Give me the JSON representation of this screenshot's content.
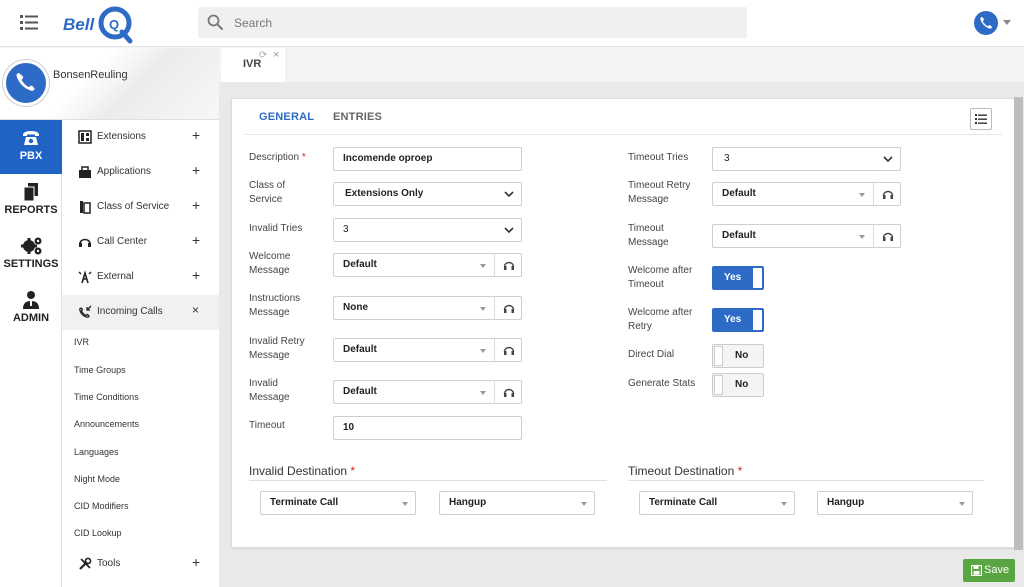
{
  "topbar": {
    "logo_text": "BellQ",
    "search_placeholder": "Search"
  },
  "user": {
    "name": "BonsenReuling"
  },
  "rail": [
    {
      "label": "PBX",
      "icon": "phone-icon",
      "active": true
    },
    {
      "label": "REPORTS",
      "icon": "documents-icon"
    },
    {
      "label": "SETTINGS",
      "icon": "gears-icon"
    },
    {
      "label": "ADMIN",
      "icon": "admin-user-icon"
    }
  ],
  "submenu": {
    "extensions": "Extensions",
    "applications": "Applications",
    "class_of_service": "Class of Service",
    "call_center": "Call Center",
    "external": "External",
    "incoming_calls": "Incoming Calls",
    "tools": "Tools",
    "plus": "+",
    "close": "×",
    "incoming_children": [
      "IVR",
      "Time Groups",
      "Time Conditions",
      "Announcements",
      "Languages",
      "Night Mode",
      "CID Modifiers",
      "CID Lookup"
    ]
  },
  "tab": {
    "label": "IVR",
    "refresh": "⟳",
    "close": "×"
  },
  "card_tabs": {
    "general": "GENERAL",
    "entries": "ENTRIES"
  },
  "form": {
    "description": {
      "label": "Description",
      "required": "*",
      "value": "Incomende oproep"
    },
    "class_of_service": {
      "label_1": "Class of",
      "label_2": "Service",
      "value": "Extensions Only"
    },
    "invalid_tries": {
      "label": "Invalid Tries",
      "value": "3"
    },
    "welcome_message": {
      "label_1": "Welcome",
      "label_2": "Message",
      "value": "Default"
    },
    "instructions_message": {
      "label_1": "Instructions",
      "label_2": "Message",
      "value": "None"
    },
    "invalid_retry_message": {
      "label_1": "Invalid Retry",
      "label_2": "Message",
      "value": "Default"
    },
    "invalid_message": {
      "label_1": "Invalid",
      "label_2": "Message",
      "value": "Default"
    },
    "timeout": {
      "label": "Timeout",
      "value": "10"
    },
    "timeout_tries": {
      "label": "Timeout Tries",
      "value": "3"
    },
    "timeout_retry_message": {
      "label_1": "Timeout Retry",
      "label_2": "Message",
      "value": "Default"
    },
    "timeout_message": {
      "label_1": "Timeout",
      "label_2": "Message",
      "value": "Default"
    },
    "welcome_after_timeout": {
      "label_1": "Welcome after",
      "label_2": "Timeout",
      "value": "Yes"
    },
    "welcome_after_retry": {
      "label_1": "Welcome after",
      "label_2": "Retry",
      "value": "Yes"
    },
    "direct_dial": {
      "label": "Direct Dial",
      "value": "No"
    },
    "generate_stats": {
      "label": "Generate Stats",
      "value": "No"
    }
  },
  "invalid_destination": {
    "title": "Invalid Destination",
    "required": "*",
    "type": "Terminate Call",
    "target": "Hangup"
  },
  "timeout_destination": {
    "title": "Timeout Destination",
    "required": "*",
    "type": "Terminate Call",
    "target": "Hangup"
  },
  "save_label": "Save",
  "colors": {
    "accent": "#2e6bc6",
    "rail_active": "#1f63c5",
    "save": "#58a541"
  }
}
